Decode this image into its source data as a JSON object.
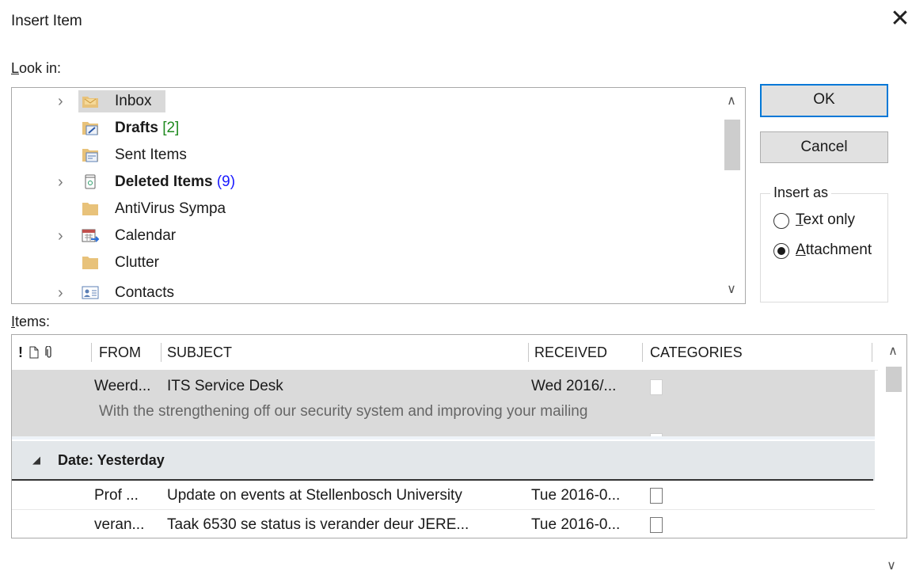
{
  "dialog": {
    "title": "Insert Item",
    "close_glyph": "✕"
  },
  "look_in": {
    "label": "Look in:",
    "label_accel": "L",
    "label_rest": "ook in:",
    "folders": [
      {
        "name": "Inbox",
        "count": "",
        "bold": false,
        "expandable": true,
        "selected": true,
        "icon": "inbox-folder-icon"
      },
      {
        "name": "Drafts",
        "count": "[2]",
        "bold": true,
        "expandable": false,
        "selected": false,
        "icon": "drafts-folder-icon"
      },
      {
        "name": "Sent Items",
        "count": "",
        "bold": false,
        "expandable": false,
        "selected": false,
        "icon": "sent-folder-icon"
      },
      {
        "name": "Deleted Items",
        "count": "(9)",
        "bold": true,
        "expandable": true,
        "selected": false,
        "icon": "trash-icon"
      },
      {
        "name": "AntiVirus Sympa",
        "count": "",
        "bold": false,
        "expandable": false,
        "selected": false,
        "icon": "folder-icon"
      },
      {
        "name": "Calendar",
        "count": "",
        "bold": false,
        "expandable": true,
        "selected": false,
        "icon": "calendar-icon"
      },
      {
        "name": "Clutter",
        "count": "",
        "bold": false,
        "expandable": false,
        "selected": false,
        "icon": "folder-icon"
      },
      {
        "name": "Contacts",
        "count": "",
        "bold": false,
        "expandable": true,
        "selected": false,
        "icon": "contacts-icon"
      }
    ]
  },
  "buttons": {
    "ok": "OK",
    "cancel": "Cancel"
  },
  "insert_as": {
    "title": "Insert as",
    "options": [
      {
        "accel": "T",
        "rest": "ext only",
        "checked": false
      },
      {
        "accel": "A",
        "rest": "ttachment",
        "checked": true
      }
    ]
  },
  "items": {
    "label_accel": "I",
    "label_rest": "tems:",
    "columns": {
      "importance": "!",
      "icon": "",
      "attachment": "",
      "from": "FROM",
      "subject": "SUBJECT",
      "received": "RECEIVED",
      "categories": "CATEGORIES"
    },
    "selected_item": {
      "from": "Weerd...",
      "subject": "ITS Service Desk",
      "received": "Wed 2016/...",
      "preview": "With the strengthening off our security system and improving your mailing"
    },
    "group": {
      "label": "Date: Yesterday"
    },
    "rows": [
      {
        "from": "Prof ...",
        "subject": "Update on events at Stellenbosch University",
        "received": "Tue 2016-0..."
      },
      {
        "from": "veran...",
        "subject": "Taak 6530 se status is verander deur JERE...",
        "received": "Tue 2016-0..."
      }
    ]
  },
  "colors": {
    "accent": "#0078d7",
    "draft_count": "#1f8a1f",
    "deleted_count": "#1a1aff",
    "selection": "#d9d9d9",
    "group_bg": "#e3e7ea"
  }
}
